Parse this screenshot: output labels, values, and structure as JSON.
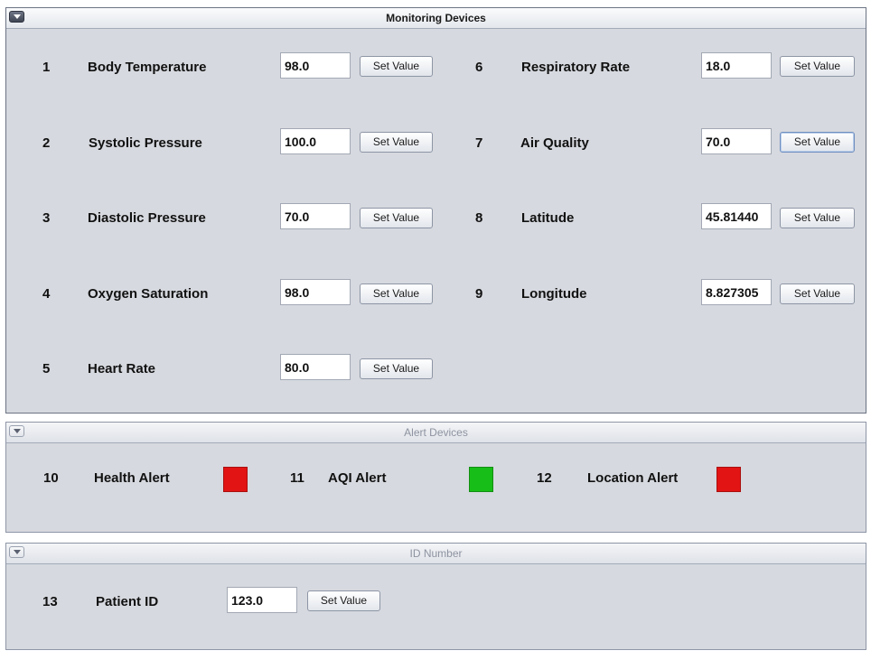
{
  "colors": {
    "alert_red": "#e31414",
    "alert_green": "#18be18"
  },
  "monitoring": {
    "title": "Monitoring Devices",
    "devices": [
      {
        "num": "1",
        "label": "Body Temperature",
        "value": "98.0",
        "button": "Set Value"
      },
      {
        "num": "2",
        "label": "Systolic Pressure",
        "value": "100.0",
        "button": "Set Value"
      },
      {
        "num": "3",
        "label": "Diastolic Pressure",
        "value": "70.0",
        "button": "Set Value"
      },
      {
        "num": "4",
        "label": "Oxygen Saturation",
        "value": "98.0",
        "button": "Set Value"
      },
      {
        "num": "5",
        "label": "Heart Rate",
        "value": "80.0",
        "button": "Set Value"
      },
      {
        "num": "6",
        "label": "Respiratory Rate",
        "value": "18.0",
        "button": "Set Value"
      },
      {
        "num": "7",
        "label": "Air Quality",
        "value": "70.0",
        "button": "Set Value"
      },
      {
        "num": "8",
        "label": "Latitude",
        "value": "45.81440",
        "button": "Set Value"
      },
      {
        "num": "9",
        "label": "Longitude",
        "value": "8.827305",
        "button": "Set Value"
      }
    ]
  },
  "alerts": {
    "title": "Alert Devices",
    "devices": [
      {
        "num": "10",
        "label": "Health Alert",
        "status": "red"
      },
      {
        "num": "11",
        "label": "AQI Alert",
        "status": "green"
      },
      {
        "num": "12",
        "label": "Location Alert",
        "status": "red"
      }
    ]
  },
  "id_panel": {
    "title": "ID Number",
    "num": "13",
    "label": "Patient ID",
    "value": "123.0",
    "button": "Set Value"
  }
}
